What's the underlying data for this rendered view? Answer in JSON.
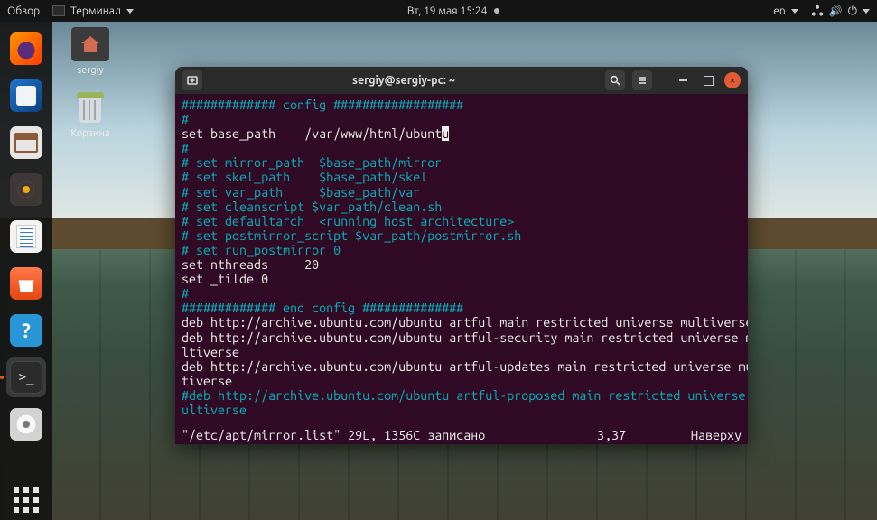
{
  "topbar": {
    "activities": "Обзор",
    "app_icon": "terminal-icon",
    "app_name": "Терминал",
    "datetime": "Вт, 19 мая  15:24",
    "lang": "en"
  },
  "desktop": {
    "home_label": "sergiy",
    "trash_label": "Корзина"
  },
  "window": {
    "title": "sergiy@sergiy-pc: ~"
  },
  "terminal": {
    "lines": [
      {
        "cls": "c-comment",
        "t": "############# config ##################"
      },
      {
        "cls": "c-comment",
        "t": "#"
      },
      {
        "cls": "c-cmd",
        "t": "set base_path    /var/www/html/ubunt",
        "cursor": "u"
      },
      {
        "cls": "c-comment",
        "t": "#"
      },
      {
        "cls": "c-comment",
        "t": "# set mirror_path  $base_path/mirror"
      },
      {
        "cls": "c-comment",
        "t": "# set skel_path    $base_path/skel"
      },
      {
        "cls": "c-comment",
        "t": "# set var_path     $base_path/var"
      },
      {
        "cls": "c-comment",
        "t": "# set cleanscript $var_path/clean.sh"
      },
      {
        "cls": "c-comment",
        "t": "# set defaultarch  <running host architecture>"
      },
      {
        "cls": "c-comment",
        "t": "# set postmirror_script $var_path/postmirror.sh"
      },
      {
        "cls": "c-comment",
        "t": "# set run_postmirror 0"
      },
      {
        "cls": "c-cmd",
        "t": "set nthreads     20"
      },
      {
        "cls": "c-cmd",
        "t": "set _tilde 0"
      },
      {
        "cls": "c-comment",
        "t": "#"
      },
      {
        "cls": "c-comment",
        "t": "############# end config ##############"
      },
      {
        "cls": "c-cmd",
        "t": ""
      },
      {
        "cls": "c-cmd",
        "t": "deb http://archive.ubuntu.com/ubuntu artful main restricted universe multiverse"
      },
      {
        "cls": "c-cmd",
        "t": "deb http://archive.ubuntu.com/ubuntu artful-security main restricted universe mu"
      },
      {
        "cls": "c-cmd",
        "t": "ltiverse"
      },
      {
        "cls": "c-cmd",
        "t": "deb http://archive.ubuntu.com/ubuntu artful-updates main restricted universe mul"
      },
      {
        "cls": "c-cmd",
        "t": "tiverse"
      },
      {
        "cls": "c-comment",
        "t": "#deb http://archive.ubuntu.com/ubuntu artful-proposed main restricted universe m"
      },
      {
        "cls": "c-comment",
        "t": "ultiverse"
      }
    ],
    "status": {
      "file": "\"/etc/apt/mirror.list\" 29L, 1356C записано",
      "pos": "3,37",
      "where": "Наверху"
    }
  }
}
